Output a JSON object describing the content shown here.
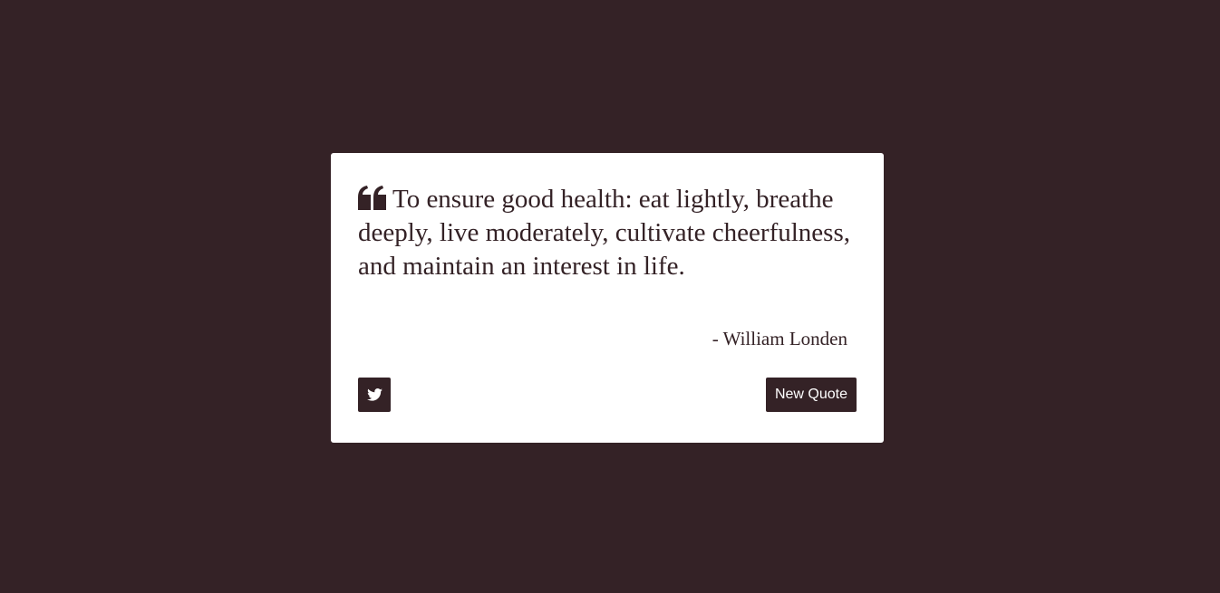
{
  "quote": {
    "text": "To ensure good health: eat lightly, breathe deeply, live moderately, cultivate cheerfulness, and maintain an interest in life.",
    "author": "- William Londen",
    "icon": "quote-left-icon"
  },
  "actions": {
    "tweet_icon": "twitter-icon",
    "new_quote_label": "New Quote"
  },
  "colors": {
    "background": "#342226",
    "card": "#ffffff",
    "text": "#342226",
    "button": "#342226",
    "button_text": "#ffffff"
  }
}
